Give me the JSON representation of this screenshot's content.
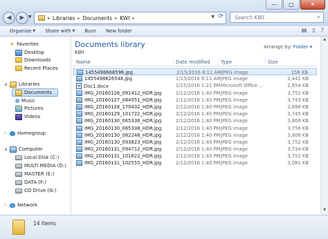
{
  "window": {
    "address": [
      "Libraries",
      "Documents",
      "KWI"
    ],
    "search_placeholder": "Search KWI",
    "controls": {
      "minimize": "—",
      "maximize": "□",
      "close": "✕"
    }
  },
  "toolbar": {
    "organize": "Organize",
    "share_with": "Share with",
    "burn": "Burn",
    "new_folder": "New folder"
  },
  "nav": {
    "favorites": "Favorites",
    "favorites_items": [
      "Desktop",
      "Downloads",
      "Recent Places"
    ],
    "libraries": "Libraries",
    "libraries_items": [
      "Documents",
      "Music",
      "Pictures",
      "Videos"
    ],
    "homegroup": "Homegroup",
    "computer": "Computer",
    "computer_items": [
      "Local Disk (C:)",
      "MULTI MEDIA (D:)",
      "MASTER (E:)",
      "DATA (F:)",
      "CD Drive (G:)"
    ],
    "network": "Network"
  },
  "main": {
    "library_title": "Documents library",
    "library_sub": "KWI",
    "arrange_label": "Arrange by:",
    "arrange_value": "Folder",
    "columns": {
      "name": "Name",
      "date": "Date modified",
      "type": "Type",
      "size": "Size"
    },
    "files": [
      {
        "name": "1455498668596.jpg",
        "date": "2/15/2016 8:11 AM",
        "type": "JPEG image",
        "size": "156 KB",
        "kind": "jpg"
      },
      {
        "name": "1455498826548.jpg",
        "date": "2/15/2016 8:11 AM",
        "type": "JPEG image",
        "size": "2,441 KB",
        "kind": "jpg"
      },
      {
        "name": "Doc1.docx",
        "date": "2/15/2016 1:21 PM",
        "type": "Microsoft Office ...",
        "size": "2,854 KB",
        "kind": "doc"
      },
      {
        "name": "IMG_20160126_091412_HDR.jpg",
        "date": "2/12/2016 1:40 PM",
        "type": "JPEG image",
        "size": "3,752 KB",
        "kind": "jpg"
      },
      {
        "name": "IMG_20160127_084551_HDR.jpg",
        "date": "2/12/2016 1:40 PM",
        "type": "JPEG image",
        "size": "3,743 KB",
        "kind": "jpg"
      },
      {
        "name": "IMG_20160128_170432_HDR.jpg",
        "date": "2/12/2016 1:40 PM",
        "type": "JPEG image",
        "size": "3,698 KB",
        "kind": "jpg"
      },
      {
        "name": "IMG_20160129_101722_HDR.jpg",
        "date": "2/12/2016 1:40 PM",
        "type": "JPEG image",
        "size": "3,745 KB",
        "kind": "jpg"
      },
      {
        "name": "IMG_20160130_065336_HDR.jpg",
        "date": "2/12/2016 1:40 PM",
        "type": "JPEG image",
        "size": "3,806 KB",
        "kind": "jpg"
      },
      {
        "name": "IMG_20160130_065338_HDR.jpg",
        "date": "2/12/2016 1:40 PM",
        "type": "JPEG image",
        "size": "3,756 KB",
        "kind": "jpg"
      },
      {
        "name": "IMG_20160130_082248_HDR.jpg",
        "date": "2/12/2016 1:40 PM",
        "type": "JPEG image",
        "size": "3,806 KB",
        "kind": "jpg"
      },
      {
        "name": "IMG_20160130_093823_HDR.jpg",
        "date": "2/12/2016 1:40 PM",
        "type": "JPEG image",
        "size": "3,752 KB",
        "kind": "jpg"
      },
      {
        "name": "IMG_20160131_094712_HDR.jpg",
        "date": "2/12/2016 1:40 PM",
        "type": "JPEG image",
        "size": "3,734 KB",
        "kind": "jpg"
      },
      {
        "name": "IMG_20160131_101622_HDR.jpg",
        "date": "2/12/2016 1:40 PM",
        "type": "JPEG image",
        "size": "3,752 KB",
        "kind": "jpg"
      },
      {
        "name": "IMG_20160131_102555_HDR.jpg",
        "date": "2/12/2016 1:40 PM",
        "type": "JPEG image",
        "size": "3,081 KB",
        "kind": "jpg"
      }
    ]
  },
  "details": {
    "count": "14 items"
  }
}
